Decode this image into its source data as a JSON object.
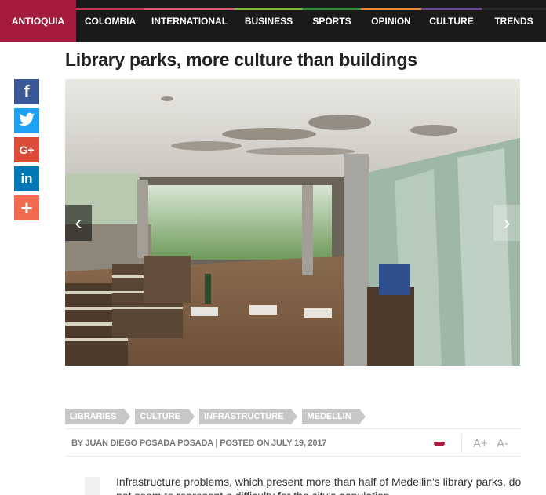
{
  "nav": {
    "items": [
      {
        "label": "ANTIOQUIA",
        "active": true,
        "color": "#a51a3d"
      },
      {
        "label": "COLOMBIA",
        "active": false,
        "color": "#c23b54"
      },
      {
        "label": "INTERNATIONAL",
        "active": false,
        "color": "#d45a72"
      },
      {
        "label": "BUSINESS",
        "active": false,
        "color": "#7bb24a"
      },
      {
        "label": "SPORTS",
        "active": false,
        "color": "#2f8f3a"
      },
      {
        "label": "OPINION",
        "active": false,
        "color": "#e3883a"
      },
      {
        "label": "CULTURE",
        "active": false,
        "color": "#6b4a9c"
      },
      {
        "label": "TRENDS",
        "active": false,
        "color": "#2a2a2a"
      }
    ]
  },
  "article": {
    "title": "Library parks, more culture than buildings",
    "tags": [
      "LIBRARIES",
      "CULTURE",
      "INFRASTRUCTURE",
      "MEDELLIN"
    ],
    "byline": "BY JUAN DIEGO POSADA POSADA | POSTED ON JULY 19, 2017",
    "font_increase": "A+",
    "font_decrease": "A-",
    "body": "Infrastructure problems, which present more than half of Medellin's library parks, do not seem to represent a difficulty for the city's population."
  },
  "share": [
    {
      "icon": "facebook-icon",
      "glyph": "f",
      "color": "#3b5998"
    },
    {
      "icon": "twitter-icon",
      "glyph": "t",
      "color": "#1da1f2"
    },
    {
      "icon": "google-plus-icon",
      "glyph": "G+",
      "color": "#dd4b39"
    },
    {
      "icon": "linkedin-icon",
      "glyph": "in",
      "color": "#0077b5"
    },
    {
      "icon": "more-share-icon",
      "glyph": "+",
      "color": "#f26a4f"
    }
  ],
  "slider": {
    "prev": "‹",
    "next": "›"
  },
  "colors": {
    "brand": "#a51a3d",
    "navbg": "#1a1a1a",
    "tag": "#c7c7c7"
  }
}
